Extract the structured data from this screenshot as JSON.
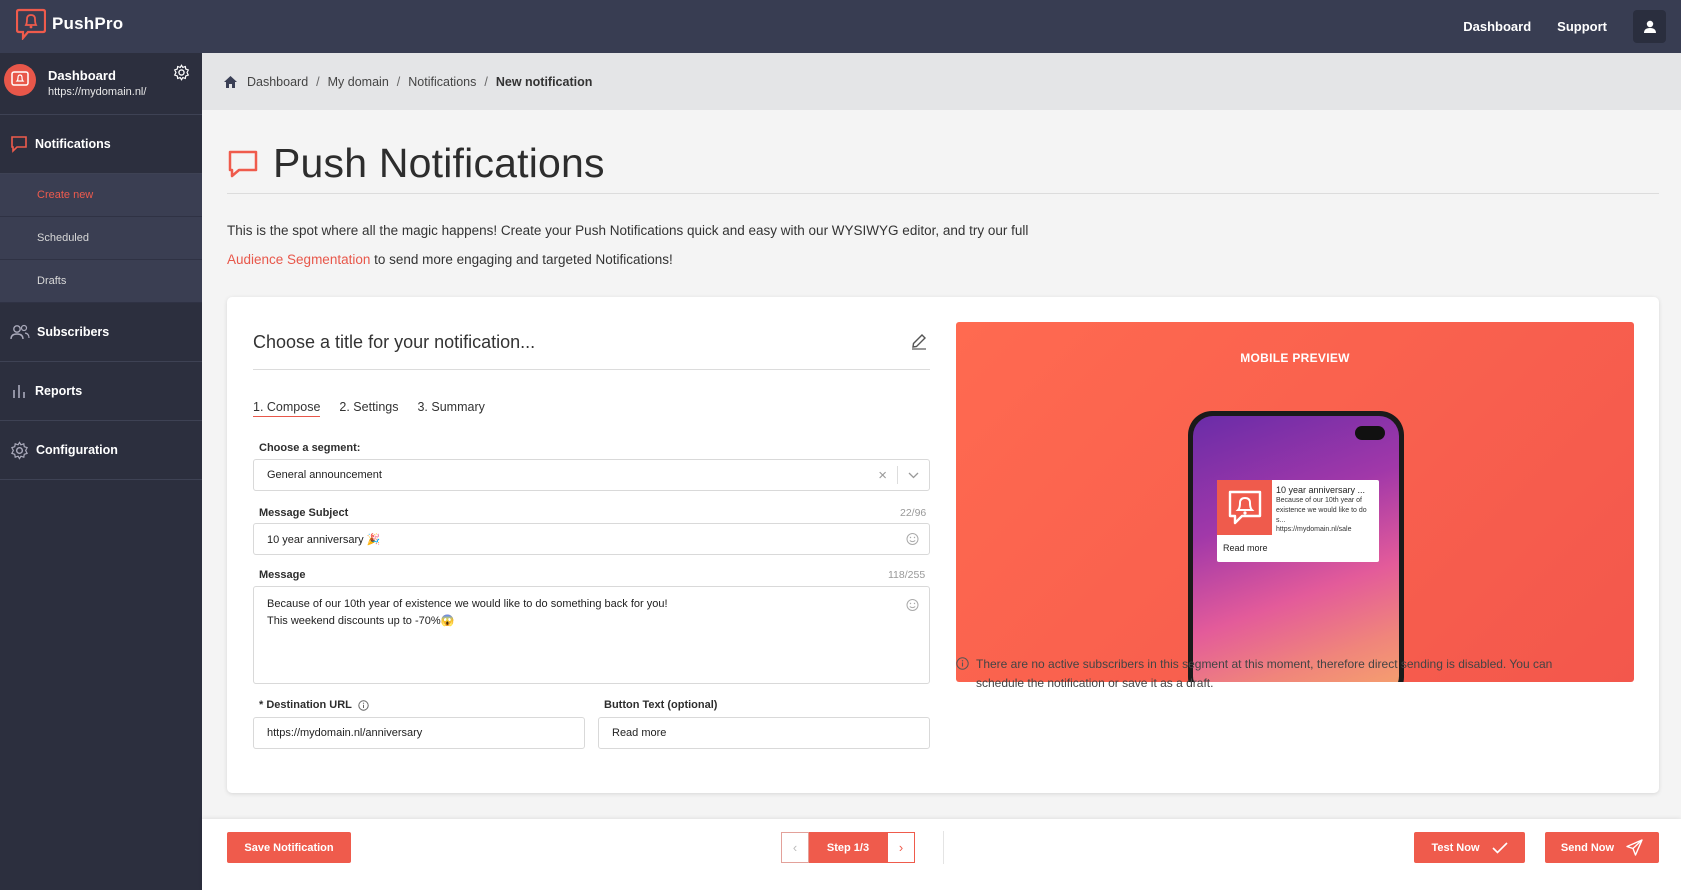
{
  "app": {
    "name": "PushPro"
  },
  "topnav": {
    "dashboard": "Dashboard",
    "support": "Support"
  },
  "sidebar": {
    "dashboard_title": "Dashboard",
    "dashboard_url": "https://mydomain.nl/",
    "items": [
      {
        "label": "Notifications",
        "icon": "chat-bubble-icon"
      },
      {
        "label": "Subscribers",
        "icon": "users-icon"
      },
      {
        "label": "Reports",
        "icon": "bar-chart-icon"
      },
      {
        "label": "Configuration",
        "icon": "gear-icon"
      }
    ],
    "sub_items": [
      "Create new",
      "Scheduled",
      "Drafts"
    ]
  },
  "breadcrumb": [
    "Dashboard",
    "My domain",
    "Notifications",
    "New notification"
  ],
  "page": {
    "title": "Push Notifications",
    "intro_text": "This is the spot where all the magic happens! Create your Push Notifications quick and easy with our WYSIWYG editor, and try our full",
    "intro_link": "Audience Segmentation",
    "intro_tail": " to send more engaging and targeted Notifications!"
  },
  "form": {
    "title_placeholder": "Choose a title for your notification...",
    "tabs": [
      "1. Compose",
      "2. Settings",
      "3. Summary"
    ],
    "segment_label": "Choose a segment:",
    "segment_value": "General announcement",
    "subject_label": "Message Subject",
    "subject_count": "22/96",
    "subject_value": "10 year anniversary 🎉",
    "message_label": "Message",
    "message_count": "118/255",
    "message_value": "Because of our 10th year of existence we would like to do something back for you!\nThis weekend discounts up to -70%😱",
    "url_label": "* Destination URL",
    "url_value": "https://mydomain.nl/anniversary",
    "button_label": "Button Text (optional)",
    "button_value": "Read more"
  },
  "preview": {
    "title": "MOBILE PREVIEW",
    "notif_title": "10 year anniversary ...",
    "notif_body": "Because of our 10th year of existence we would like to do s...",
    "notif_url": "https://mydomain.nl/sale",
    "notif_button": "Read more",
    "note": "There are no active subscribers in this segment at this moment, therefore direct sending is disabled. You can schedule the notification or save it as a draft."
  },
  "footer": {
    "save": "Save Notification",
    "step": "Step 1/3",
    "test": "Test Now",
    "send": "Send Now"
  },
  "colors": {
    "accent": "#ef5b4c",
    "sidebar": "#2c2f3e",
    "topbar": "#383d52"
  }
}
